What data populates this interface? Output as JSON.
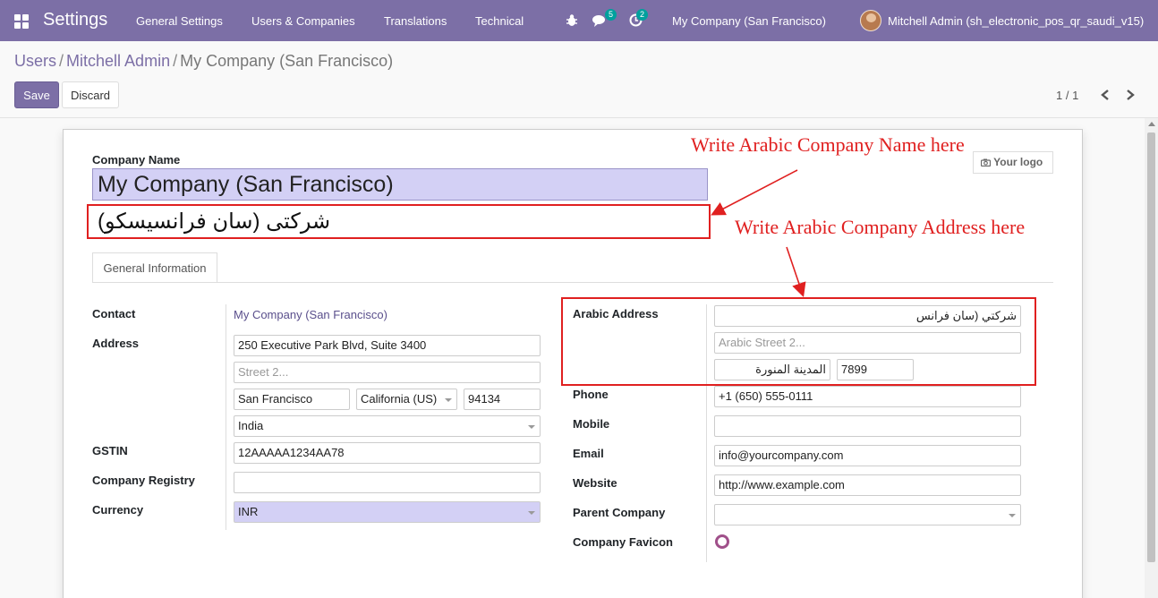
{
  "navbar": {
    "brand": "Settings",
    "menus": [
      "General Settings",
      "Users & Companies",
      "Translations",
      "Technical"
    ],
    "messages_badge": "5",
    "activities_badge": "2",
    "company": "My Company (San Francisco)",
    "user": "Mitchell Admin (sh_electronic_pos_qr_saudi_v15)",
    "accent_color": "#7c6fa6"
  },
  "breadcrumb": {
    "items": [
      "Users",
      "Mitchell Admin"
    ],
    "current": "My Company (San Francisco)"
  },
  "actions": {
    "save": "Save",
    "discard": "Discard"
  },
  "pager": {
    "text": "1 / 1"
  },
  "form": {
    "company_name_label": "Company Name",
    "company_name": "My Company (San Francisco)",
    "arabic_name": "شركتى (سان فرانسيسكو)",
    "logo_label": "Your logo",
    "tab": "General Information",
    "left": {
      "contact_label": "Contact",
      "contact": "My Company (San Francisco)",
      "address_label": "Address",
      "street": "250 Executive Park Blvd, Suite 3400",
      "street2_placeholder": "Street 2...",
      "city": "San Francisco",
      "state": "California (US)",
      "zip": "94134",
      "country": "India",
      "gstin_label": "GSTIN",
      "gstin": "12AAAAA1234AA78",
      "registry_label": "Company Registry",
      "registry": "",
      "currency_label": "Currency",
      "currency": "INR"
    },
    "right": {
      "arabic_address_label": "Arabic Address",
      "arabic_street": "شركتي (سان فرانس",
      "arabic_street2_placeholder": "Arabic Street 2...",
      "arabic_city": "المدينة المنورة",
      "arabic_zip": "7899",
      "phone_label": "Phone",
      "phone": "+1 (650) 555-0111",
      "mobile_label": "Mobile",
      "mobile": "",
      "email_label": "Email",
      "email": "info@yourcompany.com",
      "website_label": "Website",
      "website": "http://www.example.com",
      "parent_label": "Parent Company",
      "parent": "",
      "favicon_label": "Company Favicon"
    }
  },
  "annotations": {
    "name_hint": "Write Arabic Company Name here",
    "address_hint": "Write Arabic Company Address here",
    "color": "#e02020"
  }
}
